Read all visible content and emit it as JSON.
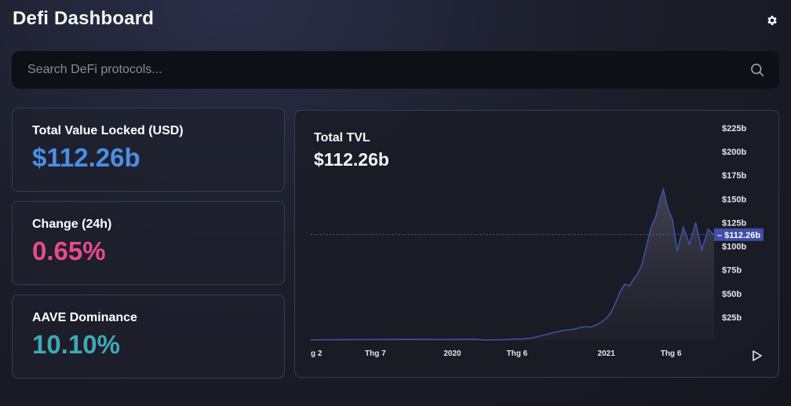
{
  "header": {
    "title": "Defi Dashboard",
    "settings_icon": "gear-icon"
  },
  "search": {
    "placeholder": "Search DeFi protocols...",
    "value": "",
    "icon": "search-icon"
  },
  "stats": [
    {
      "label": "Total Value Locked (USD)",
      "value": "$112.26b",
      "color": "#4a8fe7"
    },
    {
      "label": "Change (24h)",
      "value": "0.65%",
      "color": "#e84a8c"
    },
    {
      "label": "AAVE Dominance",
      "value": "10.10%",
      "color": "#3fa9b5"
    }
  ],
  "chart_panel": {
    "title": "Total TVL",
    "value": "$112.26b",
    "play_icon": "play-icon"
  },
  "chart_data": {
    "type": "area",
    "y_tick_labels": [
      "$25b",
      "$50b",
      "$75b",
      "$100b",
      "$125b",
      "$150b",
      "$175b",
      "$200b",
      "$225b"
    ],
    "y_ticks": [
      25,
      50,
      75,
      100,
      125,
      150,
      175,
      200,
      225
    ],
    "ylim": [
      0,
      225
    ],
    "x_tick_labels": [
      "g 2",
      "Thg 7",
      "2020",
      "Thg 6",
      "2021",
      "Thg 6"
    ],
    "x_ticks": [
      2019.09,
      2019.5,
      2020.0,
      2020.42,
      2021.0,
      2021.42
    ],
    "xlim": [
      2019.08,
      2021.7
    ],
    "current_value": 112.26,
    "current_label": "$112.26b",
    "line_color": "#3f4fa6",
    "series": [
      {
        "x": [
          2019.08,
          2019.2,
          2019.35,
          2019.5,
          2019.65,
          2019.8,
          2019.95,
          2020.05,
          2020.15,
          2020.2,
          2020.25,
          2020.35,
          2020.42,
          2020.47,
          2020.52,
          2020.55,
          2020.58,
          2020.62,
          2020.65,
          2020.68,
          2020.72,
          2020.75,
          2020.78,
          2020.82,
          2020.86,
          2020.9,
          2020.94,
          2020.97,
          2021.0,
          2021.03,
          2021.06,
          2021.09,
          2021.12,
          2021.15,
          2021.18,
          2021.2,
          2021.23,
          2021.26,
          2021.29,
          2021.32,
          2021.35,
          2021.37,
          2021.4,
          2021.43,
          2021.46,
          2021.5,
          2021.54,
          2021.58,
          2021.62,
          2021.66,
          2021.7
        ],
        "values": [
          1.0,
          1.2,
          1.3,
          1.4,
          1.5,
          1.5,
          1.4,
          1.5,
          1.6,
          1.0,
          1.0,
          1.3,
          1.8,
          2.2,
          3.0,
          4.5,
          5.5,
          7.0,
          8.5,
          9.5,
          11.0,
          11.5,
          12.0,
          13.5,
          15.0,
          14.5,
          17.0,
          20.0,
          24.0,
          30.0,
          40.0,
          52.0,
          60.0,
          58.0,
          66.0,
          70.0,
          80.0,
          100.0,
          120.0,
          131.0,
          150.0,
          160.0,
          140.0,
          128.0,
          95.0,
          120.0,
          102.0,
          125.0,
          96.0,
          118.0,
          112.26
        ]
      }
    ]
  }
}
